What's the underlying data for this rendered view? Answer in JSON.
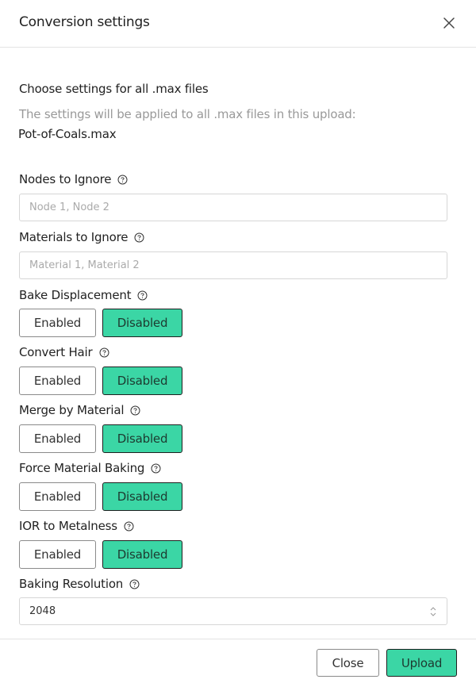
{
  "header": {
    "title": "Conversion settings",
    "close_icon": "close-icon"
  },
  "intro": {
    "heading": "Choose settings for all .max files",
    "subtext": "The settings will be applied to all .max files in this upload:",
    "filename": "Pot-of-Coals.max"
  },
  "fields": {
    "nodes_to_ignore": {
      "label": "Nodes to Ignore",
      "value": "",
      "placeholder": "Node 1, Node 2",
      "help_icon": "help-circle-icon"
    },
    "materials_to_ignore": {
      "label": "Materials to Ignore",
      "value": "",
      "placeholder": "Material 1, Material 2",
      "help_icon": "help-circle-icon"
    },
    "bake_displacement": {
      "label": "Bake Displacement",
      "enabled_label": "Enabled",
      "disabled_label": "Disabled",
      "selected": "Disabled"
    },
    "convert_hair": {
      "label": "Convert Hair",
      "enabled_label": "Enabled",
      "disabled_label": "Disabled",
      "selected": "Disabled"
    },
    "merge_by_material": {
      "label": "Merge by Material",
      "enabled_label": "Enabled",
      "disabled_label": "Disabled",
      "selected": "Disabled"
    },
    "force_material_baking": {
      "label": "Force Material Baking",
      "enabled_label": "Enabled",
      "disabled_label": "Disabled",
      "selected": "Disabled"
    },
    "ior_to_metalness": {
      "label": "IOR to Metalness",
      "enabled_label": "Enabled",
      "disabled_label": "Disabled",
      "selected": "Disabled"
    },
    "baking_resolution": {
      "label": "Baking Resolution",
      "value": "2048",
      "icon": "updown-chevron-icon"
    }
  },
  "footer": {
    "close_label": "Close",
    "upload_label": "Upload"
  },
  "colors": {
    "accent": "#3bd6a5",
    "muted_text": "#999999",
    "border": "#d6d6d6"
  }
}
